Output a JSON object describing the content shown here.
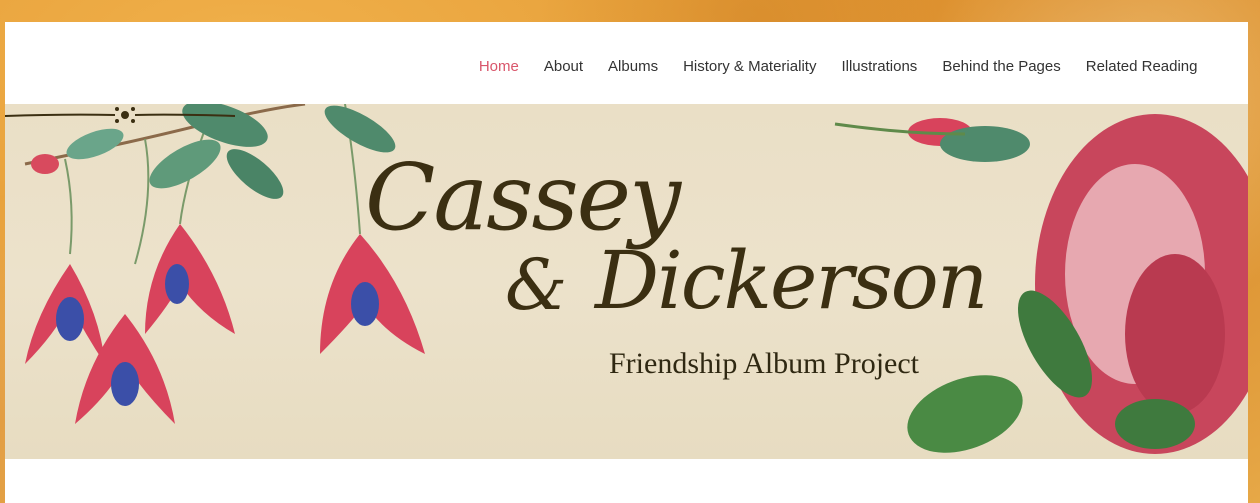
{
  "nav": {
    "items": [
      {
        "label": "Home",
        "active": true
      },
      {
        "label": "About"
      },
      {
        "label": "Albums"
      },
      {
        "label": "History & Materiality"
      },
      {
        "label": "Illustrations"
      },
      {
        "label": "Behind the Pages"
      },
      {
        "label": "Related Reading"
      }
    ]
  },
  "banner": {
    "title_line1": "Cassey",
    "title_amp": "&",
    "title_line2": "Dickerson",
    "subtitle": "Friendship Album Project",
    "ornament_icon": "floral-flourish-icon"
  },
  "colors": {
    "accent": "#d9566b",
    "nav_text": "#333333",
    "title_text": "#3b2f12",
    "banner_bg": "#eadfc6",
    "page_bg": "#e8a23c"
  }
}
